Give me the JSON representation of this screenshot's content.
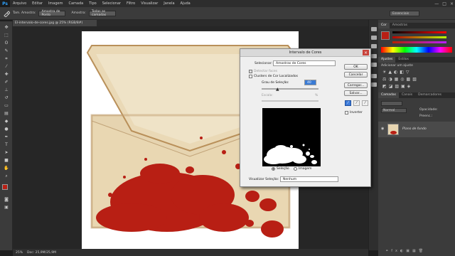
{
  "app": {
    "logo": "Ps"
  },
  "menu": [
    "Arquivo",
    "Editar",
    "Imagem",
    "Camada",
    "Tipo",
    "Selecionar",
    "Filtro",
    "Visualizar",
    "Janela",
    "Ajuda"
  ],
  "window_controls": [
    "—",
    "□",
    "×"
  ],
  "options_bar": {
    "sample_label": "Tam. Amostra:",
    "sample_value": "Amostra de Ponto",
    "sample_all_label": "Amostra:",
    "sample_all_value": "Todas as camadas",
    "workspace": "Essenciais"
  },
  "document_tab": "El-intervalo-de-cores.jpg @ 25% (RGB/8#)",
  "status": {
    "zoom": "25%",
    "doc": "Doc: 25,9M/25,9M"
  },
  "dialog": {
    "title": "Intervalo de Cores",
    "select_label": "Selecionar:",
    "select_value": "Amostras de Cores",
    "detect_faces": "Detectar faces",
    "localized": "Clusters de Cor Localizados",
    "fuzziness_label": "Grau de Seleção:",
    "fuzziness_value": "40",
    "range_label": "Escala:",
    "range_unit": "%",
    "radio_selection": "Seleção",
    "radio_image": "Imagem",
    "preview_label": "Visualizar Seleção:",
    "preview_value": "Nenhum",
    "ok": "OK",
    "cancel": "Cancelar",
    "load": "Carregar...",
    "save": "Salvar...",
    "invert": "Inverter"
  },
  "panels": {
    "color_tabs": [
      "Cor",
      "Amostras"
    ],
    "adjust_tabs": [
      "Ajustes",
      "Estilos"
    ],
    "adjust_title": "Adicionar um ajuste",
    "layer_tabs": [
      "Camadas",
      "Canais",
      "Demarcadores"
    ],
    "layer_mode": "Normal",
    "opacity_label": "Opacidade:",
    "fill_label": "Preenc.:",
    "layer_name": "Plano de fundo"
  },
  "colors": {
    "accent": "#2fa3ff",
    "blood": "#b81f14",
    "paper": "#e9d9b8",
    "fg_swatch": "#b81f14",
    "bg_swatch": "#ffffff"
  }
}
